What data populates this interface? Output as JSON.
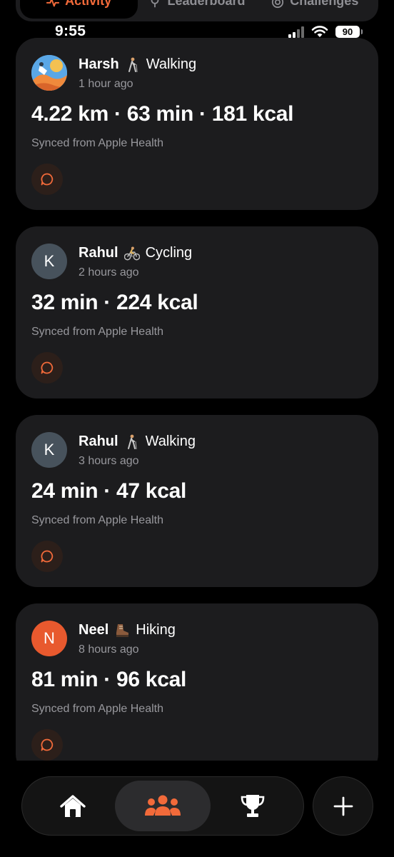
{
  "top_tabs": [
    {
      "label": "Activity",
      "active": true
    },
    {
      "label": "Leaderboard",
      "active": false
    },
    {
      "label": "Challenges",
      "active": false
    }
  ],
  "status_bar": {
    "time": "9:55",
    "battery": "90"
  },
  "feed": [
    {
      "avatar_letter": "",
      "avatar_kind": "photo",
      "user": "Harsh",
      "activity_emoji": "person-walking",
      "activity": "Walking",
      "time_ago": "1 hour ago",
      "stats": "4.22 km · 63 min · 181 kcal",
      "source": "Synced from Apple Health"
    },
    {
      "avatar_letter": "K",
      "avatar_kind": "grey",
      "user": "Rahul",
      "activity_emoji": "person-biking",
      "activity": "Cycling",
      "time_ago": "2 hours ago",
      "stats": "32 min · 224 kcal",
      "source": "Synced from Apple Health"
    },
    {
      "avatar_letter": "K",
      "avatar_kind": "grey",
      "user": "Rahul",
      "activity_emoji": "person-walking",
      "activity": "Walking",
      "time_ago": "3 hours ago",
      "stats": "24 min · 47 kcal",
      "source": "Synced from Apple Health"
    },
    {
      "avatar_letter": "N",
      "avatar_kind": "orange",
      "user": "Neel",
      "activity_emoji": "hiking-boot",
      "activity": "Hiking",
      "time_ago": "8 hours ago",
      "stats": "81 min · 96 kcal",
      "source": "Synced from Apple Health"
    }
  ],
  "bottom_nav": {
    "items": [
      {
        "icon": "home-icon",
        "active": false
      },
      {
        "icon": "community-icon",
        "active": true
      },
      {
        "icon": "trophy-icon",
        "active": false
      }
    ],
    "add_icon": "plus-icon"
  },
  "colors": {
    "accent": "#f26a3a",
    "card": "#1c1c1e",
    "background": "#000000",
    "secondary_text": "#98989d"
  }
}
